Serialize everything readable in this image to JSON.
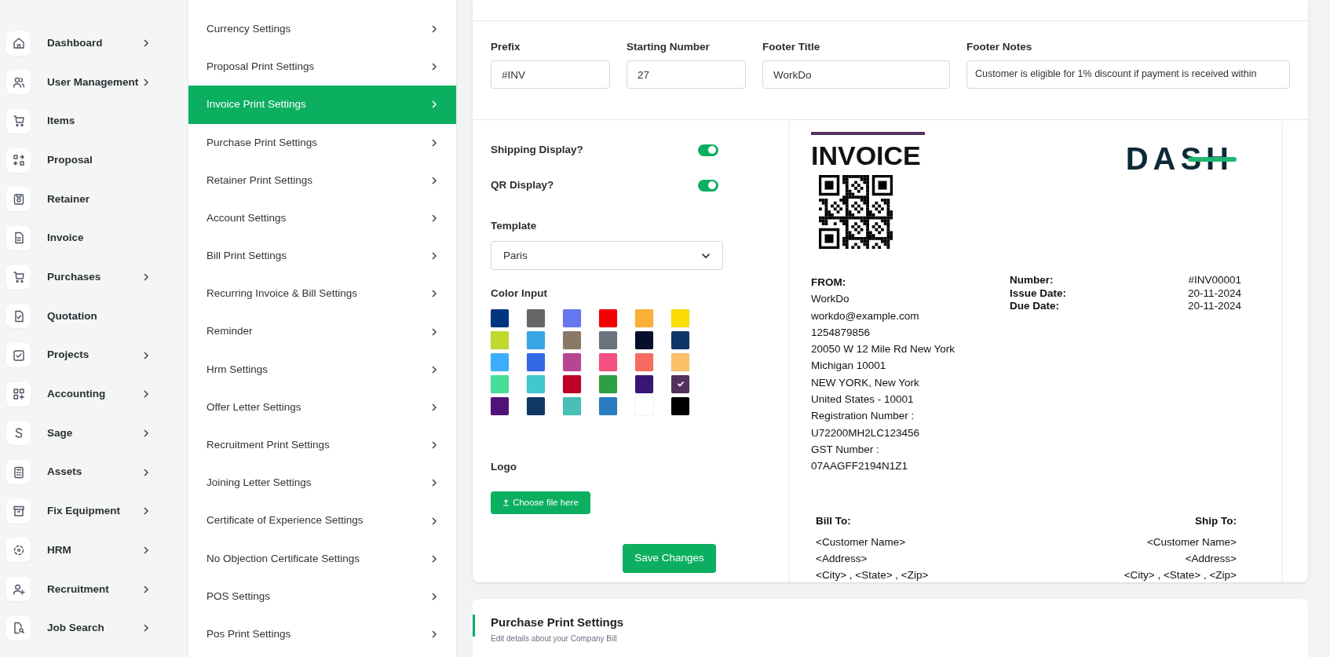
{
  "sidebar": {
    "items": [
      {
        "label": "Dashboard",
        "expandable": true
      },
      {
        "label": "User Management",
        "expandable": true
      },
      {
        "label": "Items",
        "expandable": false
      },
      {
        "label": "Proposal",
        "expandable": false
      },
      {
        "label": "Retainer",
        "expandable": false
      },
      {
        "label": "Invoice",
        "expandable": false
      },
      {
        "label": "Purchases",
        "expandable": true
      },
      {
        "label": "Quotation",
        "expandable": false
      },
      {
        "label": "Projects",
        "expandable": true
      },
      {
        "label": "Accounting",
        "expandable": true
      },
      {
        "label": "Sage",
        "expandable": true
      },
      {
        "label": "Assets",
        "expandable": true
      },
      {
        "label": "Fix Equipment",
        "expandable": true
      },
      {
        "label": "HRM",
        "expandable": true
      },
      {
        "label": "Recruitment",
        "expandable": true
      },
      {
        "label": "Job Search",
        "expandable": true
      }
    ]
  },
  "settings_menu": {
    "items": [
      {
        "label": "Currency Settings",
        "selected": false
      },
      {
        "label": "Proposal Print Settings",
        "selected": false
      },
      {
        "label": "Invoice Print Settings",
        "selected": true
      },
      {
        "label": "Purchase Print Settings",
        "selected": false
      },
      {
        "label": "Retainer Print Settings",
        "selected": false
      },
      {
        "label": "Account Settings",
        "selected": false
      },
      {
        "label": "Bill Print Settings",
        "selected": false
      },
      {
        "label": "Recurring Invoice & Bill Settings",
        "selected": false
      },
      {
        "label": "Reminder",
        "selected": false
      },
      {
        "label": "Hrm Settings",
        "selected": false
      },
      {
        "label": "Offer Letter Settings",
        "selected": false
      },
      {
        "label": "Recruitment Print Settings",
        "selected": false
      },
      {
        "label": "Joining Letter Settings",
        "selected": false
      },
      {
        "label": "Certificate of Experience Settings",
        "selected": false
      },
      {
        "label": "No Objection Certificate Settings",
        "selected": false
      },
      {
        "label": "POS Settings",
        "selected": false
      },
      {
        "label": "Pos Print Settings",
        "selected": false
      }
    ]
  },
  "invoice_settings": {
    "fields": [
      {
        "label": "Prefix",
        "value": "#INV"
      },
      {
        "label": "Starting Number",
        "value": "27"
      },
      {
        "label": "Footer Title",
        "value": "WorkDo"
      },
      {
        "label": "Footer Notes",
        "value": "Customer is eligible for 1% discount if payment is received within"
      }
    ],
    "toggles": [
      {
        "label": "Shipping Display?",
        "on": true
      },
      {
        "label": "QR Display?",
        "on": true
      }
    ],
    "template": {
      "label": "Template",
      "value": "Paris"
    },
    "color_input": {
      "label": "Color Input",
      "swatches": [
        {
          "color": "#003580",
          "selected": false
        },
        {
          "color": "#666666",
          "selected": false
        },
        {
          "color": "#6676ef",
          "selected": false
        },
        {
          "color": "#f50102",
          "selected": false
        },
        {
          "color": "#f9b034",
          "selected": false
        },
        {
          "color": "#fbdd03",
          "selected": false
        },
        {
          "color": "#c1d82f",
          "selected": false
        },
        {
          "color": "#37a4e4",
          "selected": false
        },
        {
          "color": "#8a7966",
          "selected": false
        },
        {
          "color": "#6a737b",
          "selected": false
        },
        {
          "color": "#050f2c",
          "selected": false
        },
        {
          "color": "#0e3666",
          "selected": false
        },
        {
          "color": "#3baeff",
          "selected": false
        },
        {
          "color": "#3368e6",
          "selected": false
        },
        {
          "color": "#b84592",
          "selected": false
        },
        {
          "color": "#f64f81",
          "selected": false
        },
        {
          "color": "#f66c5f",
          "selected": false
        },
        {
          "color": "#fac168",
          "selected": false
        },
        {
          "color": "#46de98",
          "selected": false
        },
        {
          "color": "#40c7d0",
          "selected": false
        },
        {
          "color": "#be0028",
          "selected": false
        },
        {
          "color": "#2f9f45",
          "selected": false
        },
        {
          "color": "#371676",
          "selected": false
        },
        {
          "color": "#52325d",
          "selected": true
        },
        {
          "color": "#511378",
          "selected": false
        },
        {
          "color": "#0f3866",
          "selected": false
        },
        {
          "color": "#48c0b6",
          "selected": false
        },
        {
          "color": "#297cc0",
          "selected": false
        },
        {
          "color": "#ffffff",
          "selected": false
        },
        {
          "color": "#000000",
          "selected": false
        }
      ]
    },
    "logo": {
      "label": "Logo",
      "button": "Choose file here"
    },
    "save_button": "Save Changes"
  },
  "invoice_preview": {
    "title": "INVOICE",
    "logo": "DASH",
    "from": {
      "heading": "FROM:",
      "lines": [
        "WorkDo",
        "workdo@example.com",
        "1254879856",
        "20050 W 12 Mile Rd New York",
        "Michigan 10001",
        "NEW YORK, New York",
        "United States - 10001",
        "Registration Number :",
        "U72200MH2LC123456",
        "GST Number :",
        "07AAGFF2194N1Z1"
      ]
    },
    "meta": [
      {
        "label": "Number:",
        "value": "#INV00001"
      },
      {
        "label": "Issue Date:",
        "value": "20-11-2024"
      },
      {
        "label": "Due Date:",
        "value": "20-11-2024"
      }
    ],
    "bill_to": {
      "heading": "Bill To:",
      "lines": [
        "<Customer Name>",
        "<Address>",
        "<City> , <State> , <Zip>"
      ]
    },
    "ship_to": {
      "heading": "Ship To:",
      "lines": [
        "<Customer Name>",
        "<Address>",
        "<City> , <State> , <Zip>"
      ]
    }
  },
  "next_section": {
    "title": "Purchase Print Settings",
    "subtitle": "Edit details about your Company Bill"
  }
}
